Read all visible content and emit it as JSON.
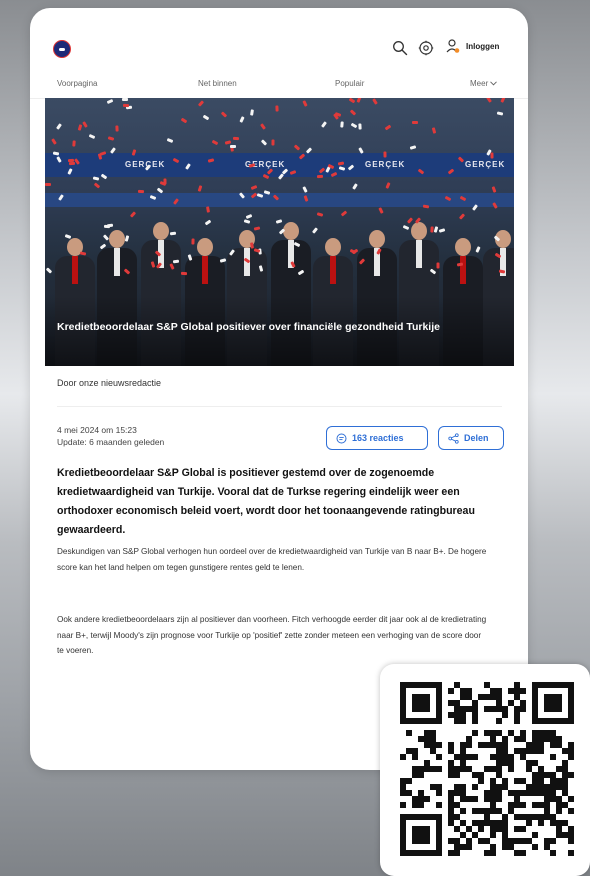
{
  "header": {
    "logo": "site-logo",
    "icons": [
      "search-icon",
      "settings-icon",
      "user-icon"
    ],
    "login_label": "Inloggen",
    "accent": "#2f6fd6"
  },
  "nav": {
    "items": [
      {
        "label": "Voorpagina"
      },
      {
        "label": "Net binnen"
      },
      {
        "label": "Populair"
      },
      {
        "label": "Meer"
      }
    ]
  },
  "hero": {
    "caption": "Kredietbeoordelaar S&P Global positiever over financiële gezondheid Turkije",
    "banner_texts": [
      "GERÇEK",
      "GERÇEK",
      "GERÇEK",
      "GERÇEK"
    ]
  },
  "article": {
    "byline": "Door onze nieuwsredactie",
    "date": "4 mei 2024 om 15:23",
    "update": "Update: 6 maanden geleden",
    "comments_label": "163 reacties",
    "share_label": "Delen",
    "lead": "Kredietbeoordelaar S&P Global is positiever gestemd over de zogenoemde kredietwaardigheid van Turkije. Vooral dat de Turkse regering eindelijk weer een orthodoxer economisch beleid voert, wordt door het toonaangevende ratingbureau gewaardeerd.",
    "paragraphs": [
      "Deskundigen van S&P Global verhogen hun oordeel over de kredietwaardigheid van Turkije van B naar B+. De hogere score kan het land helpen om tegen gunstigere rentes geld te lenen.",
      "Ook andere kredietbeoordelaars zijn al positiever dan voorheen. Fitch verhoogde eerder dit jaar ook al de kredietrating naar B+, terwijl Moody's zijn prognose voor Turkije op 'positief' zette zonder meteen een verhoging van de score door te voeren."
    ]
  },
  "qr": {
    "icon": "qr-code"
  }
}
